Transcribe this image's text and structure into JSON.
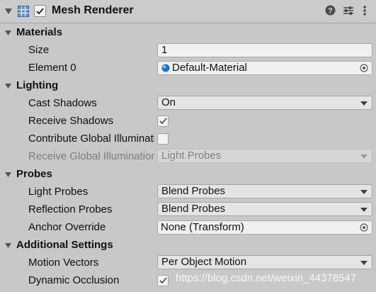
{
  "header": {
    "title": "Mesh Renderer",
    "enabled": true,
    "icons": [
      "foldout-expanded-icon",
      "mesh-renderer-icon",
      "help-icon",
      "presets-icon",
      "context-menu-icon"
    ]
  },
  "sections": {
    "materials": {
      "label": "Materials",
      "size_label": "Size",
      "size_value": "1",
      "element0_label": "Element 0",
      "element0_value": "Default-Material"
    },
    "lighting": {
      "label": "Lighting",
      "cast_shadows_label": "Cast Shadows",
      "cast_shadows_value": "On",
      "receive_shadows_label": "Receive Shadows",
      "receive_shadows_checked": true,
      "contribute_gi_label": "Contribute Global Illumination",
      "contribute_gi_checked": false,
      "receive_gi_label": "Receive Global Illumination",
      "receive_gi_value": "Light Probes"
    },
    "probes": {
      "label": "Probes",
      "light_probes_label": "Light Probes",
      "light_probes_value": "Blend Probes",
      "reflection_probes_label": "Reflection Probes",
      "reflection_probes_value": "Blend Probes",
      "anchor_override_label": "Anchor Override",
      "anchor_override_value": "None (Transform)"
    },
    "additional": {
      "label": "Additional Settings",
      "motion_vectors_label": "Motion Vectors",
      "motion_vectors_value": "Per Object Motion",
      "dynamic_occlusion_label": "Dynamic Occlusion",
      "dynamic_occlusion_checked": true
    }
  },
  "watermark": "https://blog.csdn.net/weixin_44378547",
  "colors": {
    "panel_bg": "#c8c8c8",
    "field_bg": "#f0f0f0",
    "dropdown_bg": "#e4e4e4",
    "material_icon": "#1f6fd6"
  }
}
